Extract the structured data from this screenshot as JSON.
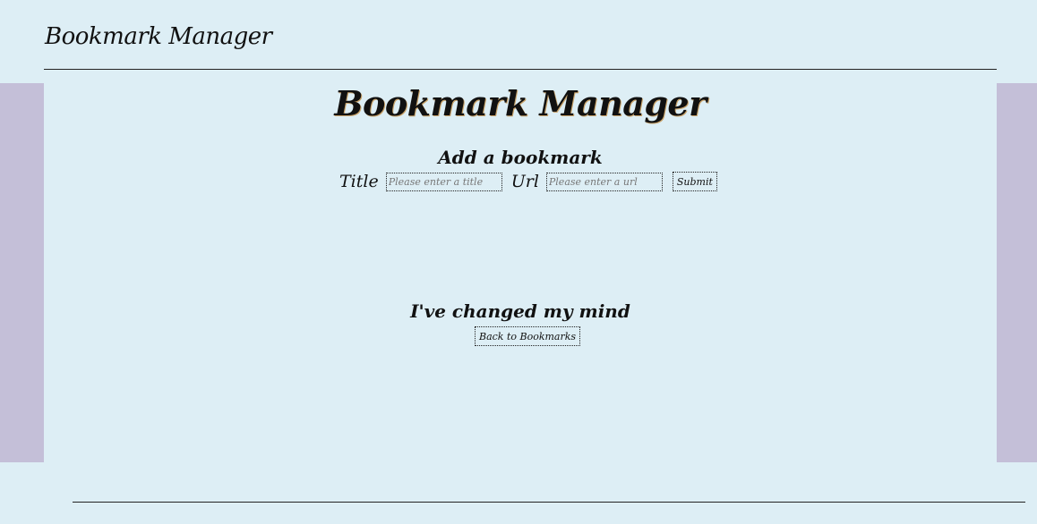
{
  "header": {
    "title": "Bookmark Manager"
  },
  "main": {
    "title": "Bookmark Manager",
    "add_section": {
      "heading": "Add a bookmark",
      "title_label": "Title",
      "title_placeholder": "Please enter a title",
      "title_value": "",
      "url_label": "Url",
      "url_placeholder": "Please enter a url",
      "url_value": "",
      "submit_label": "Submit"
    },
    "cancel_section": {
      "heading": "I've changed my mind",
      "back_label": "Back to Bookmarks"
    }
  },
  "colors": {
    "background": "#ddeef5",
    "side_panels": "#c4bfd8",
    "rule": "#222222"
  }
}
